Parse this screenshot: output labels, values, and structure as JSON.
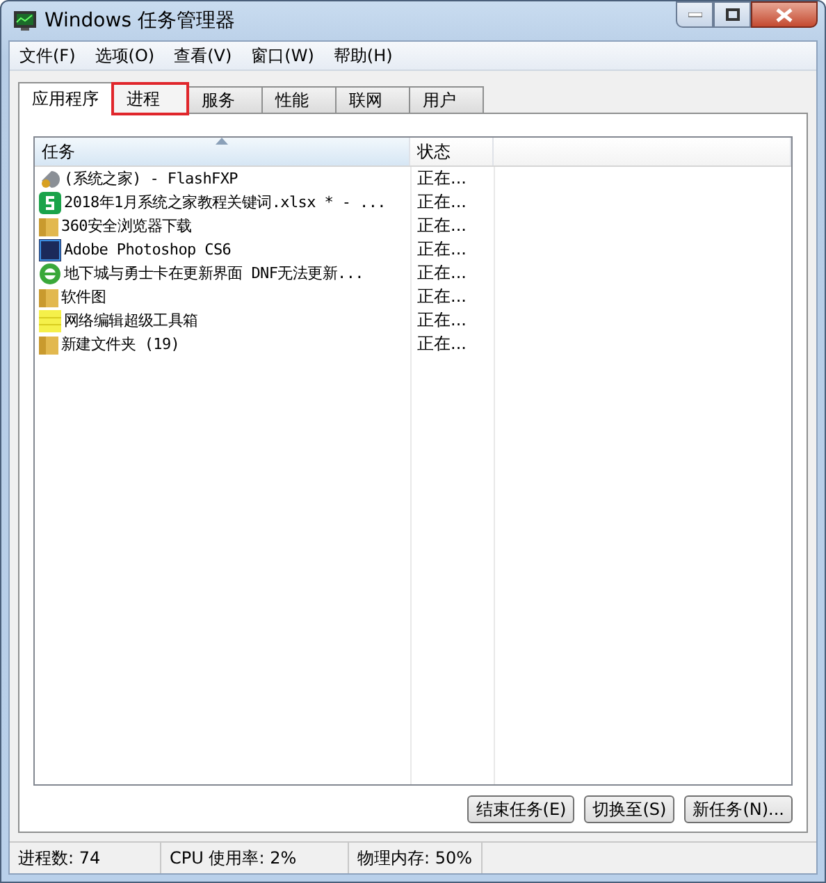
{
  "window": {
    "title": "Windows 任务管理器"
  },
  "menu": [
    "文件(F)",
    "选项(O)",
    "查看(V)",
    "窗口(W)",
    "帮助(H)"
  ],
  "tabs": [
    {
      "label": "应用程序",
      "selected": true,
      "highlighted": false
    },
    {
      "label": "进程",
      "selected": false,
      "highlighted": true
    },
    {
      "label": "服务",
      "selected": false,
      "highlighted": false
    },
    {
      "label": "性能",
      "selected": false,
      "highlighted": false
    },
    {
      "label": "联网",
      "selected": false,
      "highlighted": false
    },
    {
      "label": "用户",
      "selected": false,
      "highlighted": false
    }
  ],
  "table": {
    "columns": [
      "任务",
      "状态"
    ],
    "rows": [
      {
        "kind": "ftp",
        "task": "(系统之家) - FlashFXP",
        "status": "正在..."
      },
      {
        "kind": "sheet",
        "task": "2018年1月系统之家教程关键词.xlsx * - ...",
        "status": "正在..."
      },
      {
        "kind": "folder",
        "task": "360安全浏览器下载",
        "status": "正在..."
      },
      {
        "kind": "ps",
        "task": "Adobe Photoshop CS6",
        "status": "正在..."
      },
      {
        "kind": "browser",
        "task": "地下城与勇士卡在更新界面 DNF无法更新...",
        "status": "正在..."
      },
      {
        "kind": "folder",
        "task": "软件图",
        "status": "正在..."
      },
      {
        "kind": "notepad",
        "task": "网络编辑超级工具箱",
        "status": "正在..."
      },
      {
        "kind": "folder",
        "task": "新建文件夹 (19)",
        "status": "正在..."
      }
    ]
  },
  "buttons": [
    "结束任务(E)",
    "切换至(S)",
    "新任务(N)..."
  ],
  "status_bar": [
    "进程数: 74",
    "CPU 使用率: 2%",
    "物理内存: 50%"
  ]
}
